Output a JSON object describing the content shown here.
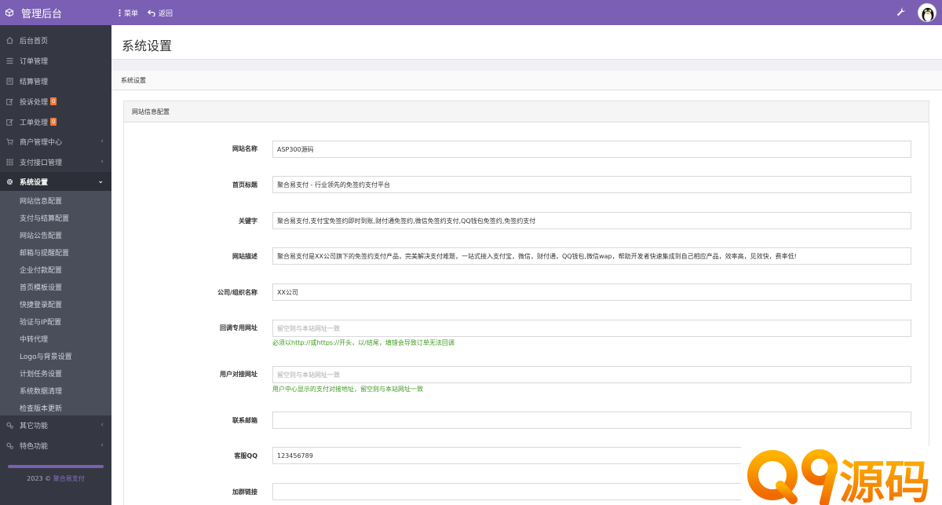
{
  "app": {
    "title": "管理后台"
  },
  "topbar": {
    "menu_label": "菜单",
    "back_label": "返回"
  },
  "sidebar": {
    "items": [
      {
        "label": "后台首页",
        "icon": "home-icon"
      },
      {
        "label": "订单管理",
        "icon": "list-icon"
      },
      {
        "label": "结算管理",
        "icon": "ledger-icon"
      },
      {
        "label": "投诉处理",
        "icon": "edit-icon",
        "badge": "0"
      },
      {
        "label": "工单处理",
        "icon": "edit-icon",
        "badge": "0"
      },
      {
        "label": "商户管理中心",
        "icon": "cart-icon"
      },
      {
        "label": "支付接口管理",
        "icon": "grid-icon"
      },
      {
        "label": "系统设置",
        "icon": "gear-icon"
      }
    ],
    "submenu": [
      "网站信息配置",
      "支付与结算配置",
      "网站公告配置",
      "邮箱与提醒配置",
      "企业付款配置",
      "首页模板设置",
      "快捷登录配置",
      "验证与IP配置",
      "中转代理",
      "Logo与背景设置",
      "计划任务设置",
      "系统数据清理",
      "检查版本更新"
    ],
    "extra": [
      {
        "label": "其它功能",
        "icon": "cogs-icon"
      },
      {
        "label": "特色功能",
        "icon": "cogs-icon"
      }
    ],
    "copyright_year": "2023 ©",
    "copyright_link": "聚合易支付"
  },
  "page": {
    "title": "系统设置",
    "panel_title": "系统设置",
    "section_title": "网站信息配置"
  },
  "form": [
    {
      "label": "网站名称",
      "value": "ASP300源码",
      "placeholder": ""
    },
    {
      "label": "首页标题",
      "value": "聚合易支付 - 行业领先的免签约支付平台",
      "placeholder": ""
    },
    {
      "label": "关键字",
      "value": "聚合易支付,支付宝免签约即时到账,财付通免签约,微信免签约支付,QQ钱包免签约,免签约支付",
      "placeholder": ""
    },
    {
      "label": "网站描述",
      "value": "聚合易支付是XX公司旗下的免签约支付产品，完美解决支付难题，一站式接入支付宝，微信，财付通，QQ钱包,微信wap，帮助开发者快速集成到自己相应产品，效率高，见效快，费率低!",
      "placeholder": ""
    },
    {
      "label": "公司/组织名称",
      "value": "XX公司",
      "placeholder": ""
    },
    {
      "label": "回调专用网址",
      "value": "",
      "placeholder": "留空则与本站网址一致",
      "help": "必须以http://或https://开头，以/结尾，填错会导致订单无法回调"
    },
    {
      "label": "用户对接网址",
      "value": "",
      "placeholder": "留空则与本站网址一致",
      "help": "用户中心显示的支付对接地址，留空则与本站网址一致"
    },
    {
      "label": "联系邮箱",
      "value": "",
      "placeholder": ""
    },
    {
      "label": "客服QQ",
      "value": "123456789",
      "placeholder": ""
    },
    {
      "label": "加群链接",
      "value": "",
      "placeholder": ""
    }
  ],
  "watermark": {
    "text": "Q9源码"
  },
  "colors": {
    "accent": "#7b5fb4",
    "sidebar": "#353842",
    "help": "#3c9a1f",
    "watermark": "#f5a100"
  }
}
